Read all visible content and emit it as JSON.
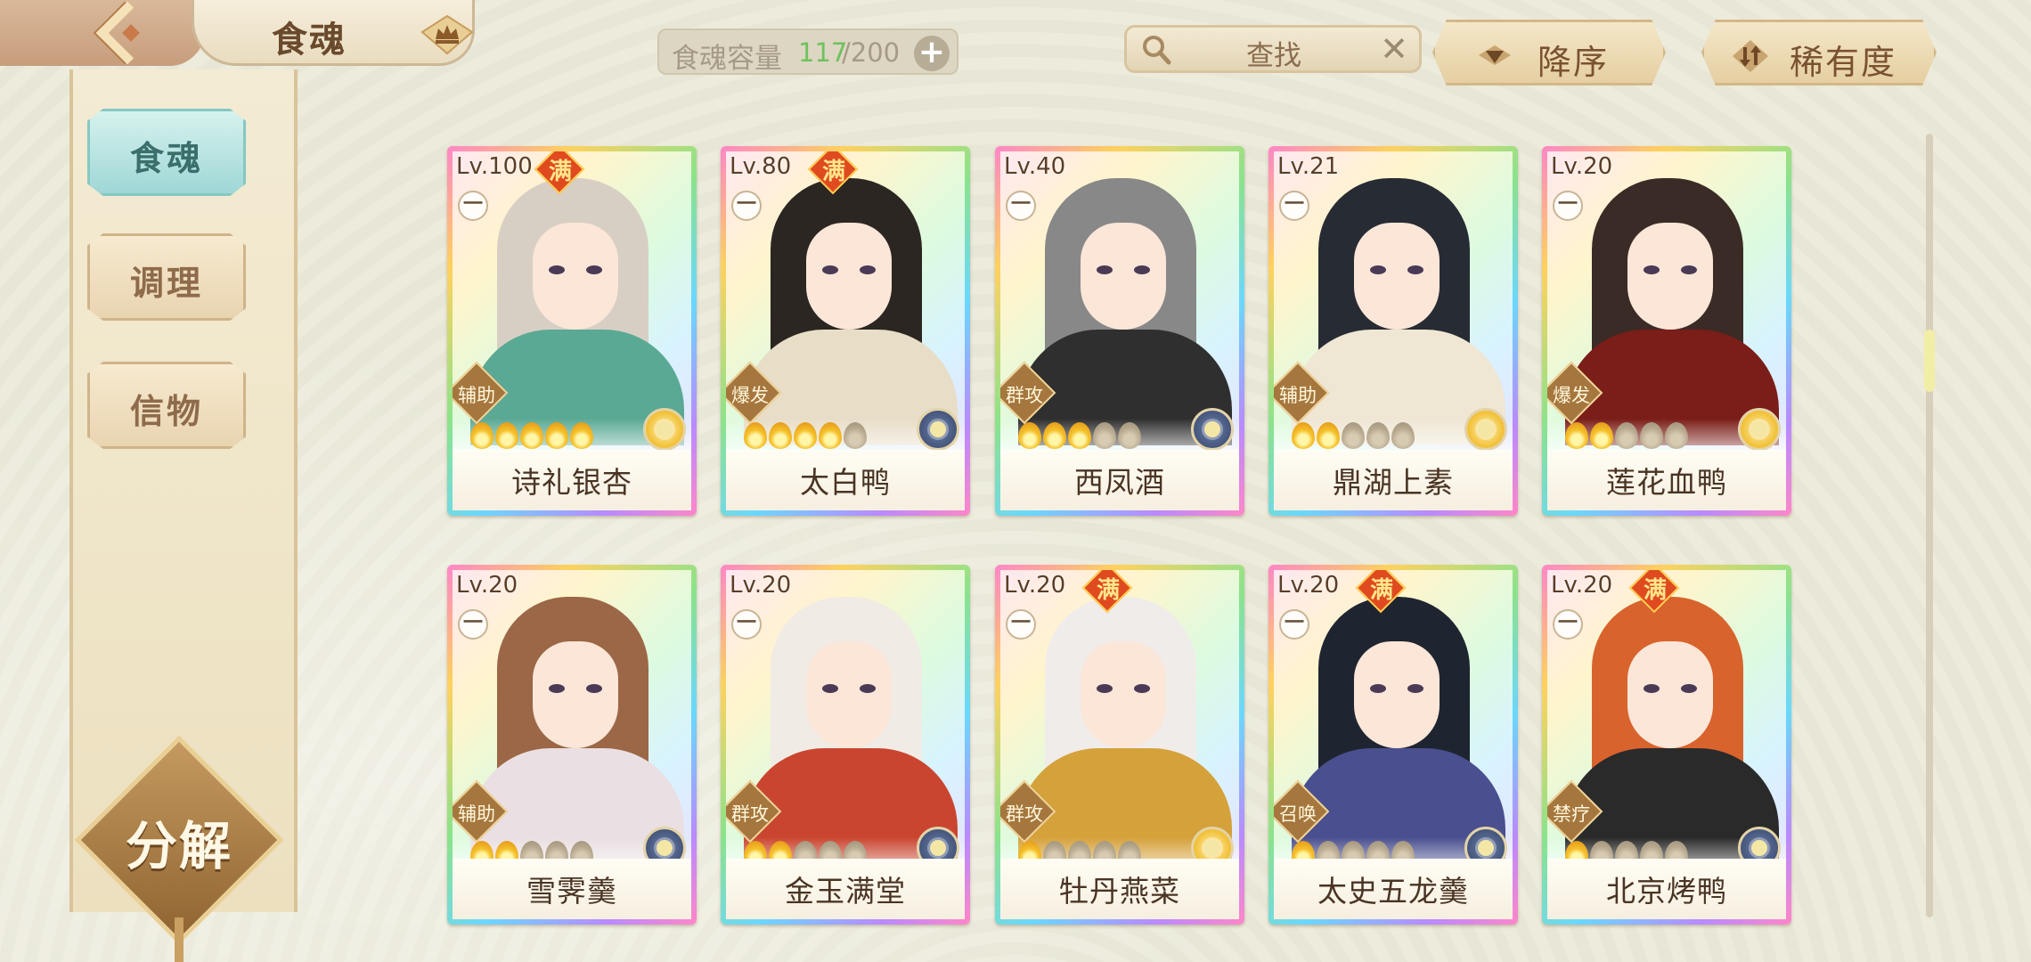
{
  "header": {
    "title": "食魂",
    "capacity_label": "食魂容量",
    "capacity_used": "117",
    "capacity_total": "/200",
    "search_placeholder": "查找",
    "sort_label": "降序",
    "rarity_label": "稀有度"
  },
  "sidebar": {
    "items": [
      {
        "label": "食魂",
        "active": true
      },
      {
        "label": "调理",
        "active": false
      },
      {
        "label": "信物",
        "active": false
      }
    ],
    "decompose_label": "分解"
  },
  "colors": {
    "accent_teal": "#9fd7d6",
    "capacity_green": "#6fc25e",
    "max_badge": "#e04a1f"
  },
  "cards": [
    {
      "level": "Lv.100",
      "max": true,
      "max_label": "满",
      "rank": "一",
      "role": "辅助",
      "stars": 5,
      "star_slots": 5,
      "element": "gold",
      "name": "诗礼银杏"
    },
    {
      "level": "Lv.80",
      "max": true,
      "max_label": "满",
      "rank": "一",
      "role": "爆发",
      "stars": 4,
      "star_slots": 5,
      "element": "blue",
      "name": "太白鸭"
    },
    {
      "level": "Lv.40",
      "max": false,
      "max_label": "",
      "rank": "一",
      "role": "群攻",
      "stars": 3,
      "star_slots": 5,
      "element": "blue",
      "name": "西凤酒"
    },
    {
      "level": "Lv.21",
      "max": false,
      "max_label": "",
      "rank": "一",
      "role": "辅助",
      "stars": 2,
      "star_slots": 5,
      "element": "gold",
      "name": "鼎湖上素"
    },
    {
      "level": "Lv.20",
      "max": false,
      "max_label": "",
      "rank": "一",
      "role": "爆发",
      "stars": 2,
      "star_slots": 5,
      "element": "gold",
      "name": "莲花血鸭"
    },
    {
      "level": "Lv.20",
      "max": false,
      "max_label": "",
      "rank": "一",
      "role": "辅助",
      "stars": 2,
      "star_slots": 5,
      "element": "blue",
      "name": "雪霁羹"
    },
    {
      "level": "Lv.20",
      "max": false,
      "max_label": "",
      "rank": "一",
      "role": "群攻",
      "stars": 2,
      "star_slots": 5,
      "element": "blue",
      "name": "金玉满堂"
    },
    {
      "level": "Lv.20",
      "max": true,
      "max_label": "满",
      "rank": "一",
      "role": "群攻",
      "stars": 1,
      "star_slots": 5,
      "element": "gold",
      "name": "牡丹燕菜"
    },
    {
      "level": "Lv.20",
      "max": true,
      "max_label": "满",
      "rank": "一",
      "role": "召唤",
      "stars": 1,
      "star_slots": 5,
      "element": "blue",
      "name": "太史五龙羹"
    },
    {
      "level": "Lv.20",
      "max": true,
      "max_label": "满",
      "rank": "一",
      "role": "禁疗",
      "stars": 1,
      "star_slots": 5,
      "element": "blue",
      "name": "北京烤鸭"
    }
  ]
}
